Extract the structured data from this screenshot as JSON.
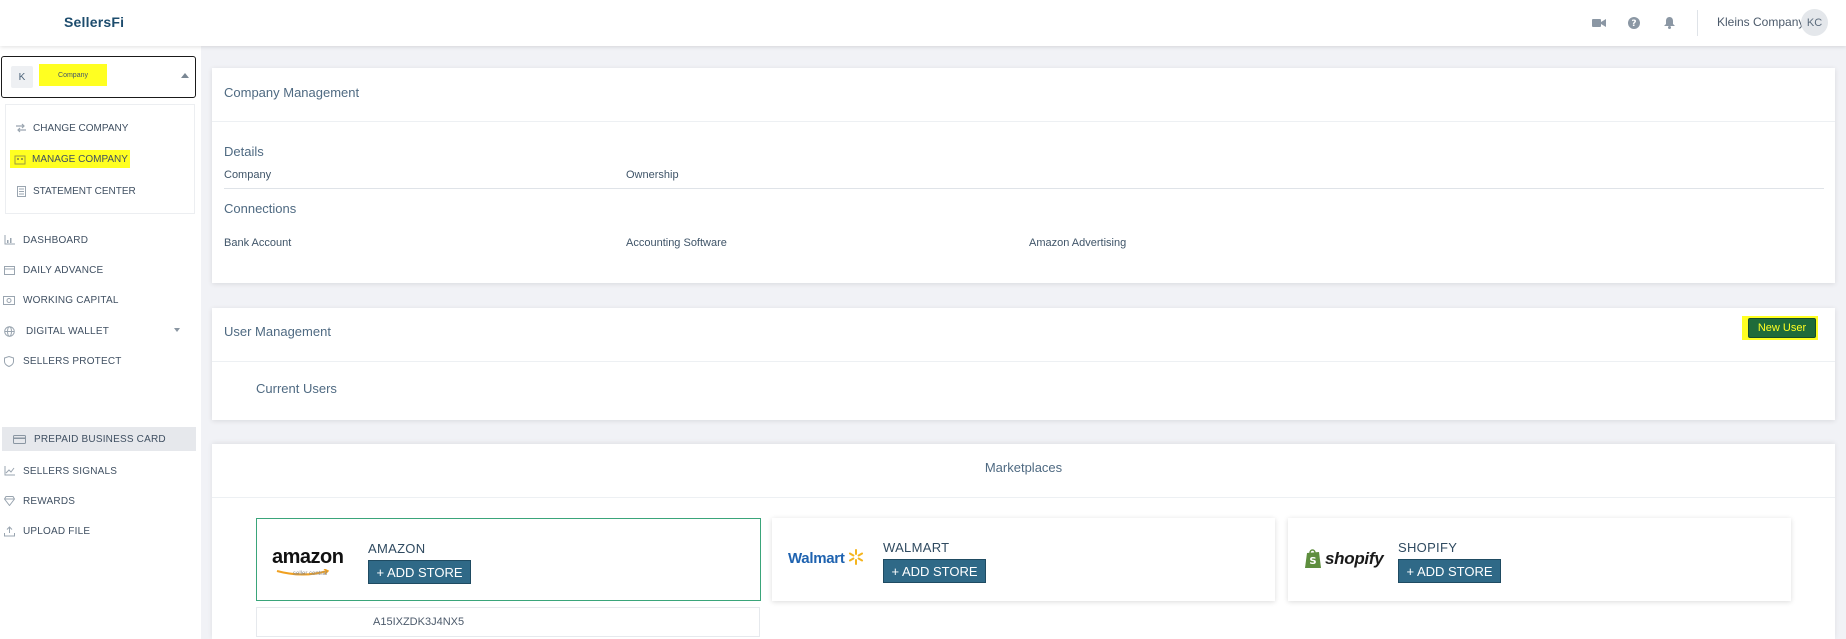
{
  "header": {
    "logo": "SellersFi",
    "user_name": "Kleins Company",
    "user_initials": "KC",
    "icons": [
      "video-icon",
      "help-icon",
      "bell-icon"
    ]
  },
  "sidebar": {
    "company": {
      "initial": "K",
      "name": "Company"
    },
    "company_menu": [
      {
        "label": "CHANGE COMPANY",
        "icon": "swap-icon"
      },
      {
        "label": "MANAGE COMPANY",
        "icon": "building-icon"
      },
      {
        "label": "STATEMENT CENTER",
        "icon": "document-icon"
      }
    ],
    "nav": [
      {
        "label": "DASHBOARD",
        "icon": "chart-icon"
      },
      {
        "label": "DAILY ADVANCE",
        "icon": "calendar-icon"
      },
      {
        "label": "WORKING CAPITAL",
        "icon": "cash-icon"
      },
      {
        "label": "DIGITAL WALLET",
        "icon": "globe-icon"
      },
      {
        "label": "SELLERS PROTECT",
        "icon": "shield-icon"
      },
      {
        "label": "PREPAID BUSINESS CARD",
        "icon": "card-icon"
      },
      {
        "label": "SELLERS SIGNALS",
        "icon": "trend-icon"
      },
      {
        "label": "REWARDS",
        "icon": "gem-icon"
      },
      {
        "label": "UPLOAD FILE",
        "icon": "upload-icon"
      }
    ]
  },
  "company_management": {
    "title": "Company Management",
    "details_title": "Details",
    "details_cols": [
      "Company",
      "Ownership"
    ],
    "connections_title": "Connections",
    "connections_cols": [
      "Bank Account",
      "Accounting Software",
      "Amazon Advertising"
    ]
  },
  "user_management": {
    "title": "User Management",
    "new_user_label": "New User",
    "current_users_label": "Current Users"
  },
  "marketplaces": {
    "title": "Marketplaces",
    "add_store_label": "+ ADD STORE",
    "stores": [
      {
        "name": "AMAZON",
        "logo": "amazon",
        "logo_sub": "seller central"
      },
      {
        "name": "WALMART",
        "logo": "Walmart"
      },
      {
        "name": "SHOPIFY",
        "logo": "shopify"
      }
    ],
    "amazon_store_id": "A15IXZDK3J4NX5"
  },
  "colors": {
    "highlight": "#ffff21",
    "primary_button": "#2f6987",
    "new_user_button": "#1f6b3a",
    "selected_border": "#3aa57a"
  }
}
